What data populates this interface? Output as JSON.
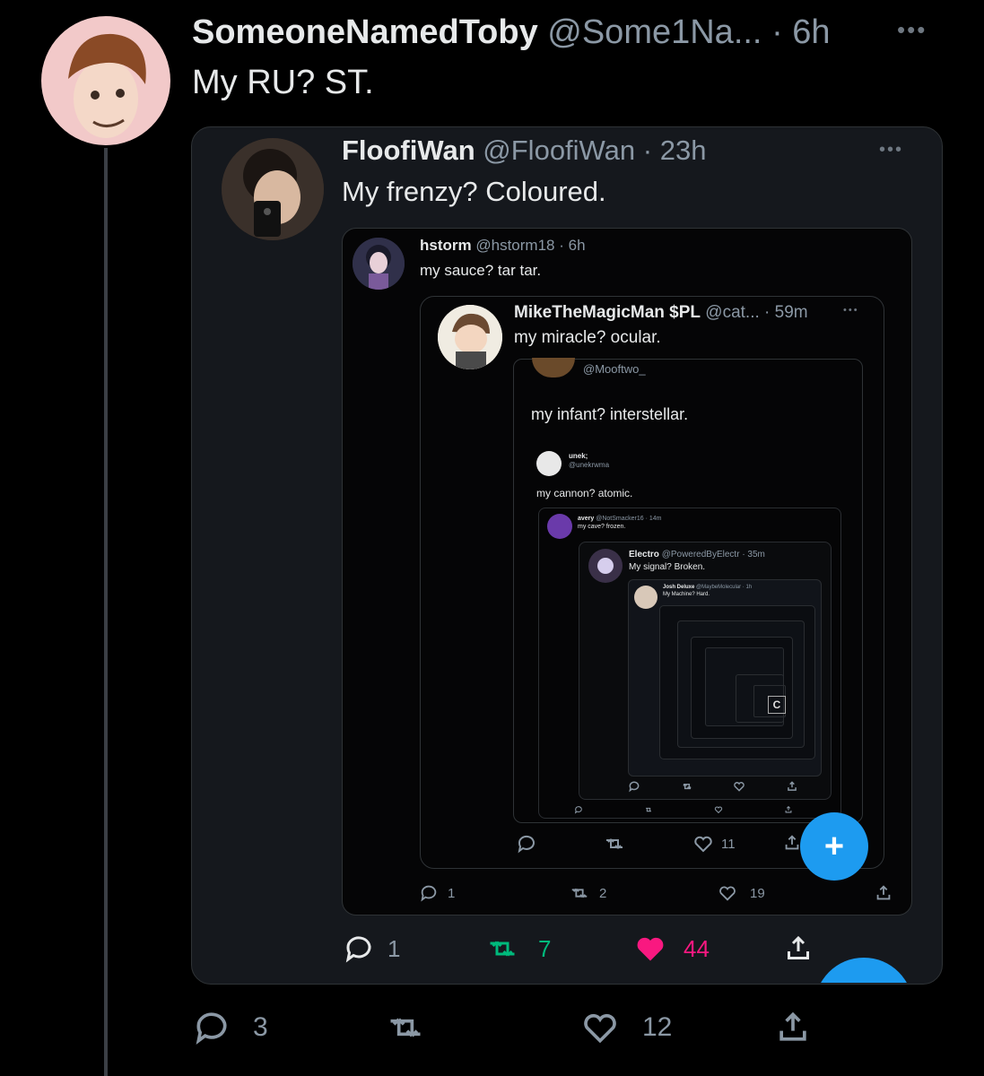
{
  "main_tweet": {
    "display_name": "SomeoneNamedToby",
    "handle": "@Some1Na...",
    "sep": "·",
    "time": "6h",
    "more": "•••",
    "text": "My RU? ST.",
    "actions": {
      "reply_count": "3",
      "retweet_count": "",
      "like_count": "12"
    }
  },
  "quote_1": {
    "display_name": "FloofiWan",
    "handle": "@FloofiWan",
    "sep": "·",
    "time": "23h",
    "more": "•••",
    "text": "My frenzy? Coloured.",
    "actions": {
      "reply_count": "1",
      "retweet_count": "7",
      "like_count": "44"
    }
  },
  "quote_2": {
    "display_name": "hstorm",
    "handle": "@hstorm18",
    "sep": "·",
    "time": "6h",
    "text": "my sauce? tar tar.",
    "actions": {
      "reply_count": "1",
      "retweet_count": "2",
      "like_count": "19"
    }
  },
  "quote_3": {
    "display_name": "MikeTheMagicMan $PL",
    "handle": "@cat...",
    "sep": "·",
    "time": "59m",
    "more": "•••",
    "text": "my miracle? ocular.",
    "actions": {
      "like_count": "11"
    }
  },
  "quote_4": {
    "handle": "@Mooftwo_",
    "text": "my infant? interstellar."
  },
  "quote_5": {
    "display_name": "unek;",
    "handle": "@unekrwma",
    "text": "my cannon? atomic."
  },
  "quote_6": {
    "display_name": "avery",
    "handle": "@NotSmacker16 · 14m",
    "text": "my cave? frozen."
  },
  "quote_7": {
    "display_name": "Electro",
    "handle": "@PoweredByElectr · 35m",
    "text": "My signal? Broken."
  },
  "quote_8": {
    "display_name": "Josh Deluxe",
    "handle": "@MaybeMolecular · 1h",
    "text": "My Machine? Hard."
  },
  "deep_glyph": "C",
  "fab": {
    "label": "+"
  },
  "colors": {
    "accent": "#1d9bf0",
    "like": "#f91880",
    "retweet": "#00ba7c",
    "muted": "#8b98a5"
  }
}
